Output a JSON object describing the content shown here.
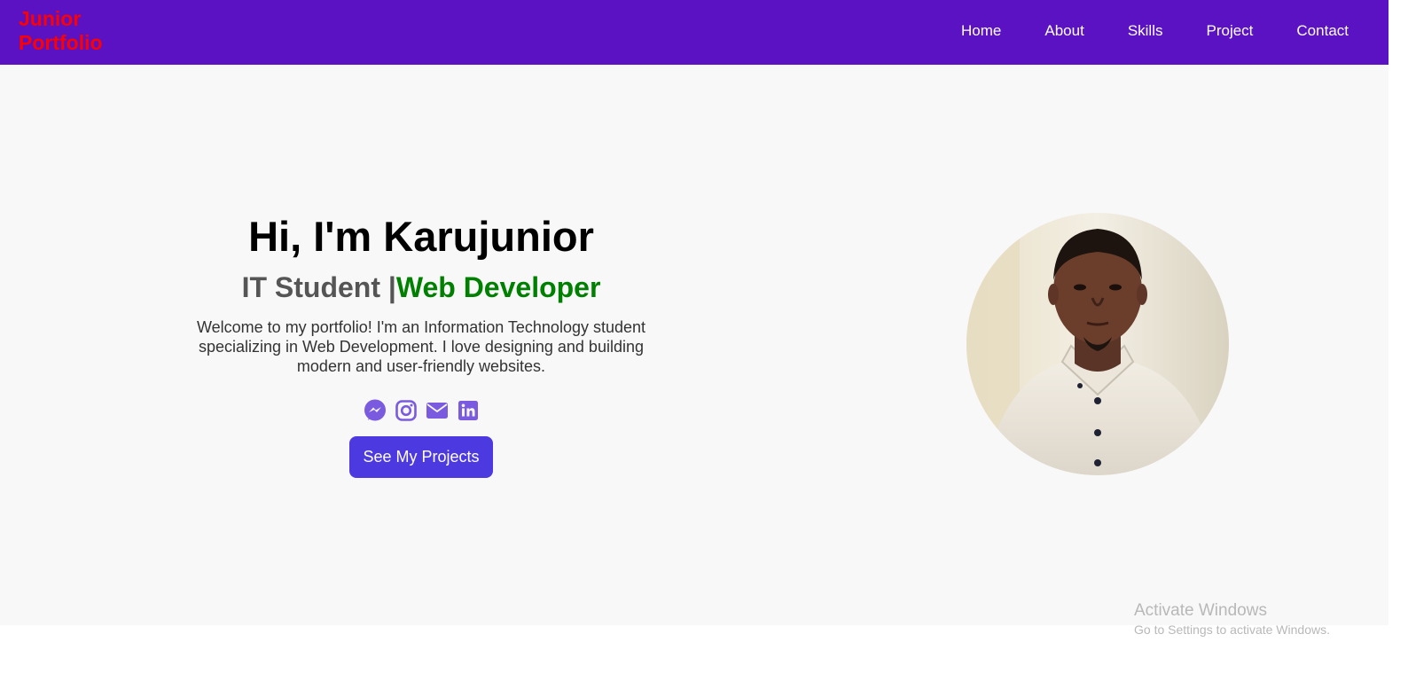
{
  "brand": {
    "line1": "Junior",
    "line2": "Portfolio",
    "color": "#ff0000"
  },
  "nav": {
    "background": "#5b12c2",
    "items": [
      {
        "label": "Home"
      },
      {
        "label": "About"
      },
      {
        "label": "Skills"
      },
      {
        "label": "Project"
      },
      {
        "label": "Contact"
      }
    ]
  },
  "hero": {
    "title": "Hi, I'm Karujunior",
    "subtitle_static": "IT Student |",
    "subtitle_typed": "Web Developer",
    "description": "Welcome to my portfolio! I'm an Information Technology student specializing in Web Development. I love designing and building modern and user-friendly websites.",
    "socials": [
      {
        "icon": "messenger-icon"
      },
      {
        "icon": "instagram-icon"
      },
      {
        "icon": "envelope-icon"
      },
      {
        "icon": "linkedin-icon"
      }
    ],
    "cta_label": "See My Projects",
    "accent": "#4c3ae0",
    "typed_color": "#008000"
  },
  "os_watermark": {
    "title": "Activate Windows",
    "subtitle": "Go to Settings to activate Windows."
  }
}
